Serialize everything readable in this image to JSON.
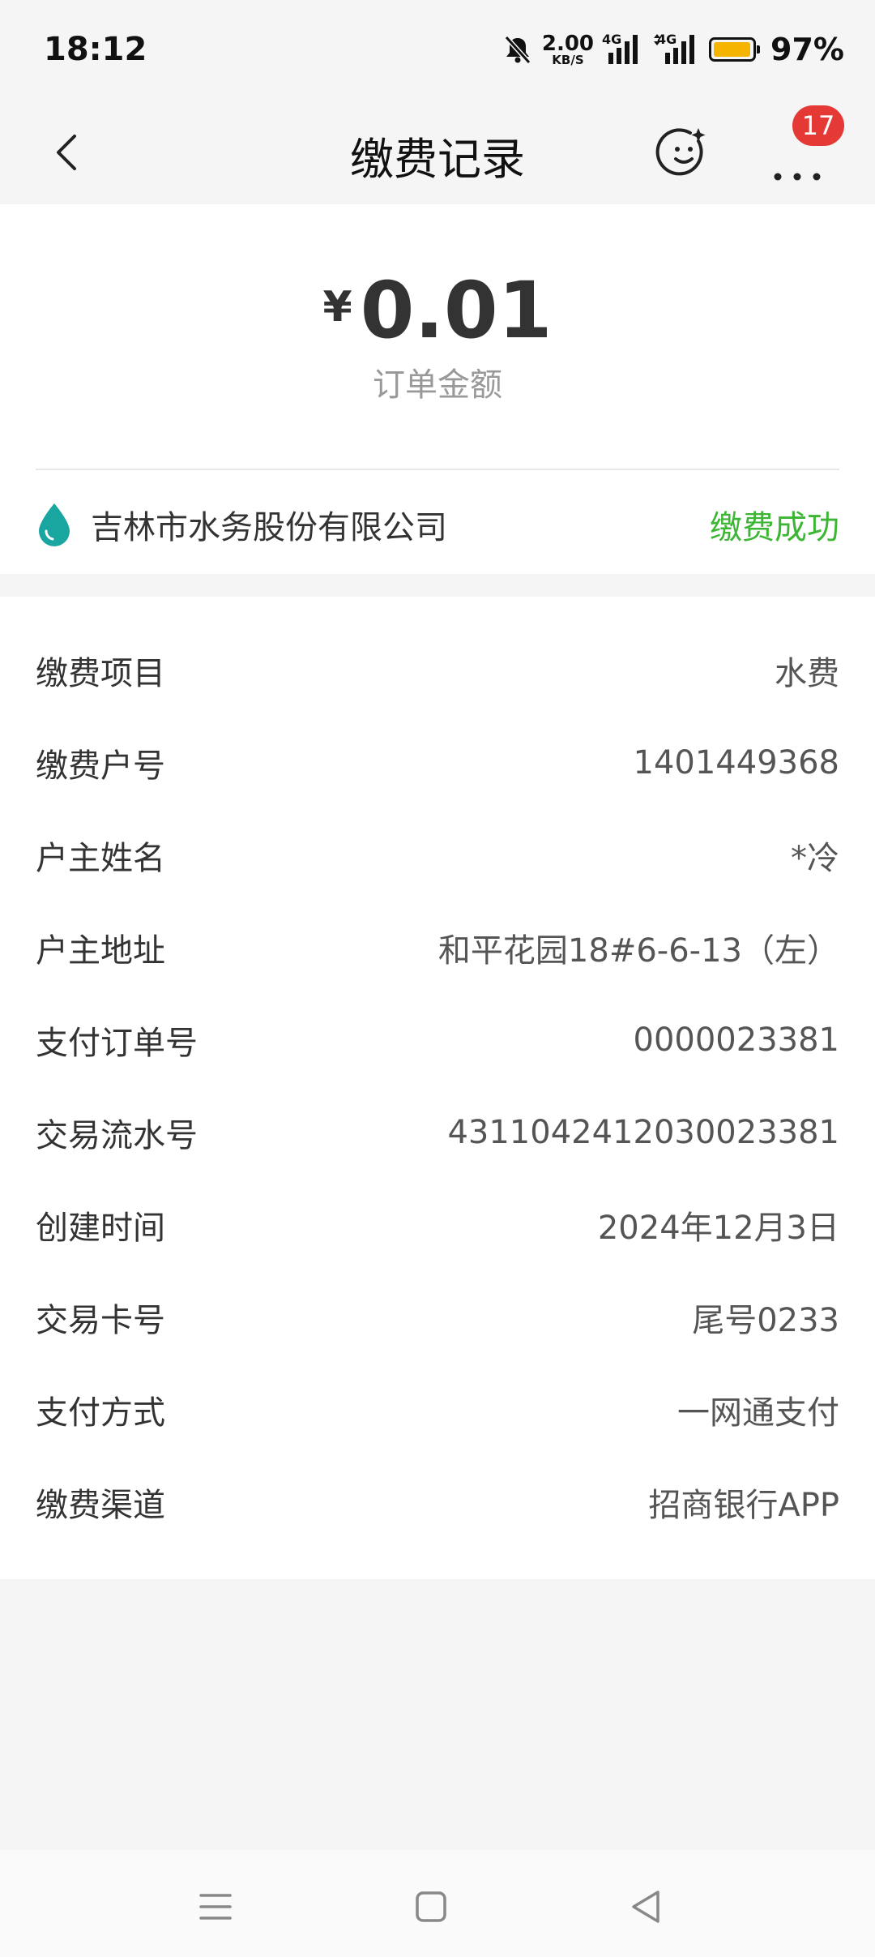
{
  "status_bar": {
    "time": "18:12",
    "net_speed_value": "2.00",
    "net_speed_unit": "KB/S",
    "signal1_label": "4G",
    "signal2_label": "4G",
    "battery_percent": "97%",
    "battery_level": 0.97,
    "icons": [
      "mute-bell-icon",
      "signal-icon",
      "signal-icon",
      "battery-icon"
    ]
  },
  "nav": {
    "title": "缴费记录",
    "badge_count": "17",
    "icons": [
      "back-icon",
      "assistant-smile-icon",
      "more-icon"
    ]
  },
  "summary": {
    "currency": "¥",
    "amount": "0.01",
    "amount_label": "订单金额",
    "company": "吉林市水务股份有限公司",
    "status": "缴费成功",
    "company_icon": "water-drop-icon",
    "status_color": "#3db535",
    "drop_color": "#1aa6a0"
  },
  "details": [
    {
      "label": "缴费项目",
      "value": "水费"
    },
    {
      "label": "缴费户号",
      "value": "1401449368"
    },
    {
      "label": "户主姓名",
      "value": "*冷"
    },
    {
      "label": "户主地址",
      "value": "和平花园18#6-6-13（左）"
    },
    {
      "label": "支付订单号",
      "value": "0000023381"
    },
    {
      "label": "交易流水号",
      "value": "4311042412030023381"
    },
    {
      "label": "创建时间",
      "value": "2024年12月3日"
    },
    {
      "label": "交易卡号",
      "value": "尾号0233"
    },
    {
      "label": "支付方式",
      "value": "一网通支付"
    },
    {
      "label": "缴费渠道",
      "value": "招商银行APP"
    }
  ],
  "system_nav": {
    "icons": [
      "menu-icon",
      "home-square-icon",
      "back-triangle-icon"
    ]
  }
}
